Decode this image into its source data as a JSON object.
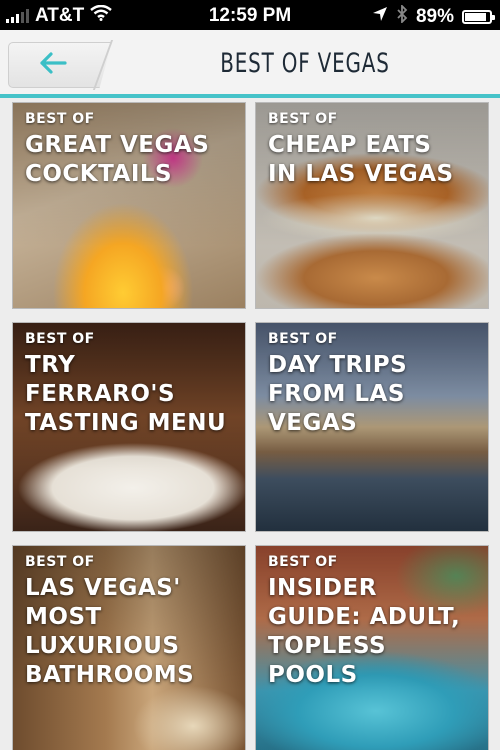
{
  "status_bar": {
    "carrier": "AT&T",
    "time": "12:59 PM",
    "battery": "89%",
    "battery_level": 0.89,
    "icons": [
      "signal-icon",
      "wifi-icon",
      "location-icon",
      "bluetooth-icon",
      "battery-icon"
    ]
  },
  "header": {
    "back_icon": "arrow-left-icon",
    "title": "BEST OF VEGAS"
  },
  "colors": {
    "accent": "#46c3c9",
    "title_text": "#1e2a36"
  },
  "tiles": [
    {
      "eyebrow": "BEST OF",
      "title": "GREAT VEGAS\nCOCKTAILS"
    },
    {
      "eyebrow": "BEST OF",
      "title": "CHEAP EATS\nIN LAS VEGAS"
    },
    {
      "eyebrow": "BEST OF",
      "title": "TRY\nFERRARO'S\nTASTING MENU"
    },
    {
      "eyebrow": "BEST OF",
      "title": "DAY TRIPS\nFROM LAS\nVEGAS"
    },
    {
      "eyebrow": "BEST OF",
      "title": "LAS VEGAS'\nMOST\nLUXURIOUS\nBATHROOMS"
    },
    {
      "eyebrow": "BEST OF",
      "title": "INSIDER\nGUIDE: ADULT,\nTOPLESS\nPOOLS"
    }
  ]
}
